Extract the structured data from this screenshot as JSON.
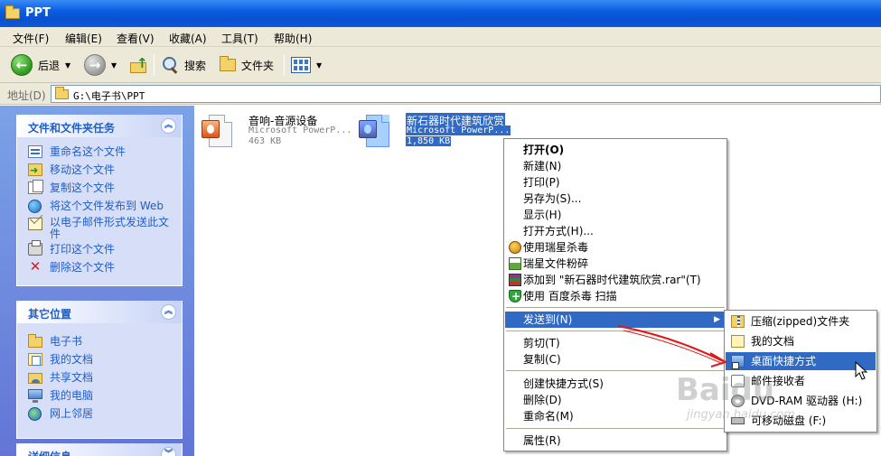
{
  "window": {
    "title": "PPT"
  },
  "menu": [
    "文件(F)",
    "编辑(E)",
    "查看(V)",
    "收藏(A)",
    "工具(T)",
    "帮助(H)"
  ],
  "toolbar": {
    "back_label": "后退",
    "search_label": "搜索",
    "folders_label": "文件夹"
  },
  "address": {
    "label": "地址(D)",
    "value": "G:\\电子书\\PPT"
  },
  "left_pane": {
    "tasks": {
      "title": "文件和文件夹任务",
      "items": [
        "重命名这个文件",
        "移动这个文件",
        "复制这个文件",
        "将这个文件发布到 Web",
        "以电子邮件形式发送此文件",
        "打印这个文件",
        "删除这个文件"
      ]
    },
    "places": {
      "title": "其它位置",
      "items": [
        "电子书",
        "我的文档",
        "共享文档",
        "我的电脑",
        "网上邻居"
      ]
    },
    "details": {
      "title": "详细信息"
    }
  },
  "files": [
    {
      "name": "音响-音源设备",
      "type": "Microsoft PowerP...",
      "size": "463 KB",
      "selected": false
    },
    {
      "name": "新石器时代建筑欣赏",
      "type": "Microsoft PowerP...",
      "size": "1,850 KB",
      "selected": true
    }
  ],
  "context_menu": {
    "items": [
      "打开(O)",
      "新建(N)",
      "打印(P)",
      "另存为(S)...",
      "显示(H)",
      "打开方式(H)...",
      "使用瑞星杀毒",
      "瑞星文件粉碎",
      "添加到 \"新石器时代建筑欣赏.rar\"(T)",
      "使用 百度杀毒 扫描",
      "发送到(N)",
      "剪切(T)",
      "复制(C)",
      "创建快捷方式(S)",
      "删除(D)",
      "重命名(M)",
      "属性(R)"
    ]
  },
  "send_to_menu": {
    "items": [
      "压缩(zipped)文件夹",
      "我的文档",
      "桌面快捷方式",
      "邮件接收者",
      "DVD-RAM 驱动器 (H:)",
      "可移动磁盘 (F:)"
    ]
  },
  "watermark": {
    "brand": "Baidu",
    "url": "jingyan.baidu.com"
  },
  "colors": {
    "titlebar": "#0b5ee0",
    "selection": "#316ac5",
    "task_link": "#215dc6",
    "annotation_arrow": "#e01818"
  }
}
